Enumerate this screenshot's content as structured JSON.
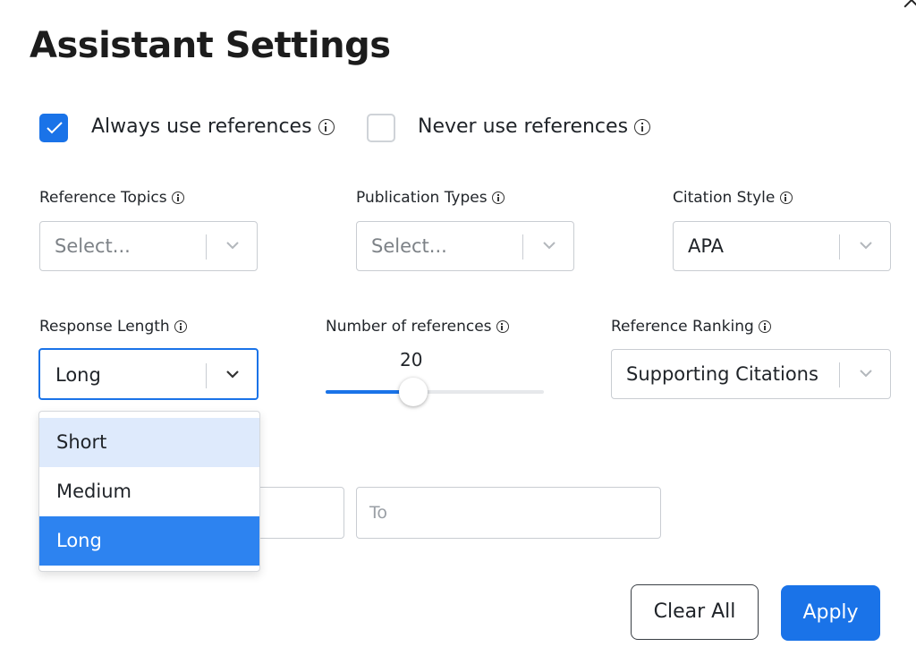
{
  "title": "Assistant Settings",
  "checkboxes": {
    "always": {
      "label": "Always use references",
      "checked": true
    },
    "never": {
      "label": "Never use references",
      "checked": false
    }
  },
  "fields": {
    "reference_topics": {
      "label": "Reference Topics",
      "placeholder": "Select..."
    },
    "publication_types": {
      "label": "Publication Types",
      "placeholder": "Select..."
    },
    "citation_style": {
      "label": "Citation Style",
      "value": "APA"
    },
    "response_length": {
      "label": "Response Length",
      "value": "Long"
    },
    "number_of_references": {
      "label": "Number of references",
      "value": "20",
      "fraction": 0.4
    },
    "reference_ranking": {
      "label": "Reference Ranking",
      "value": "Supporting Citations"
    }
  },
  "response_length_menu": [
    "Short",
    "Medium",
    "Long"
  ],
  "date_range": {
    "to_placeholder": "To"
  },
  "buttons": {
    "clear": "Clear All",
    "apply": "Apply"
  },
  "colors": {
    "accent": "#1a73e8",
    "menu_hover": "#deeafc",
    "menu_selected": "#2d83f0"
  }
}
